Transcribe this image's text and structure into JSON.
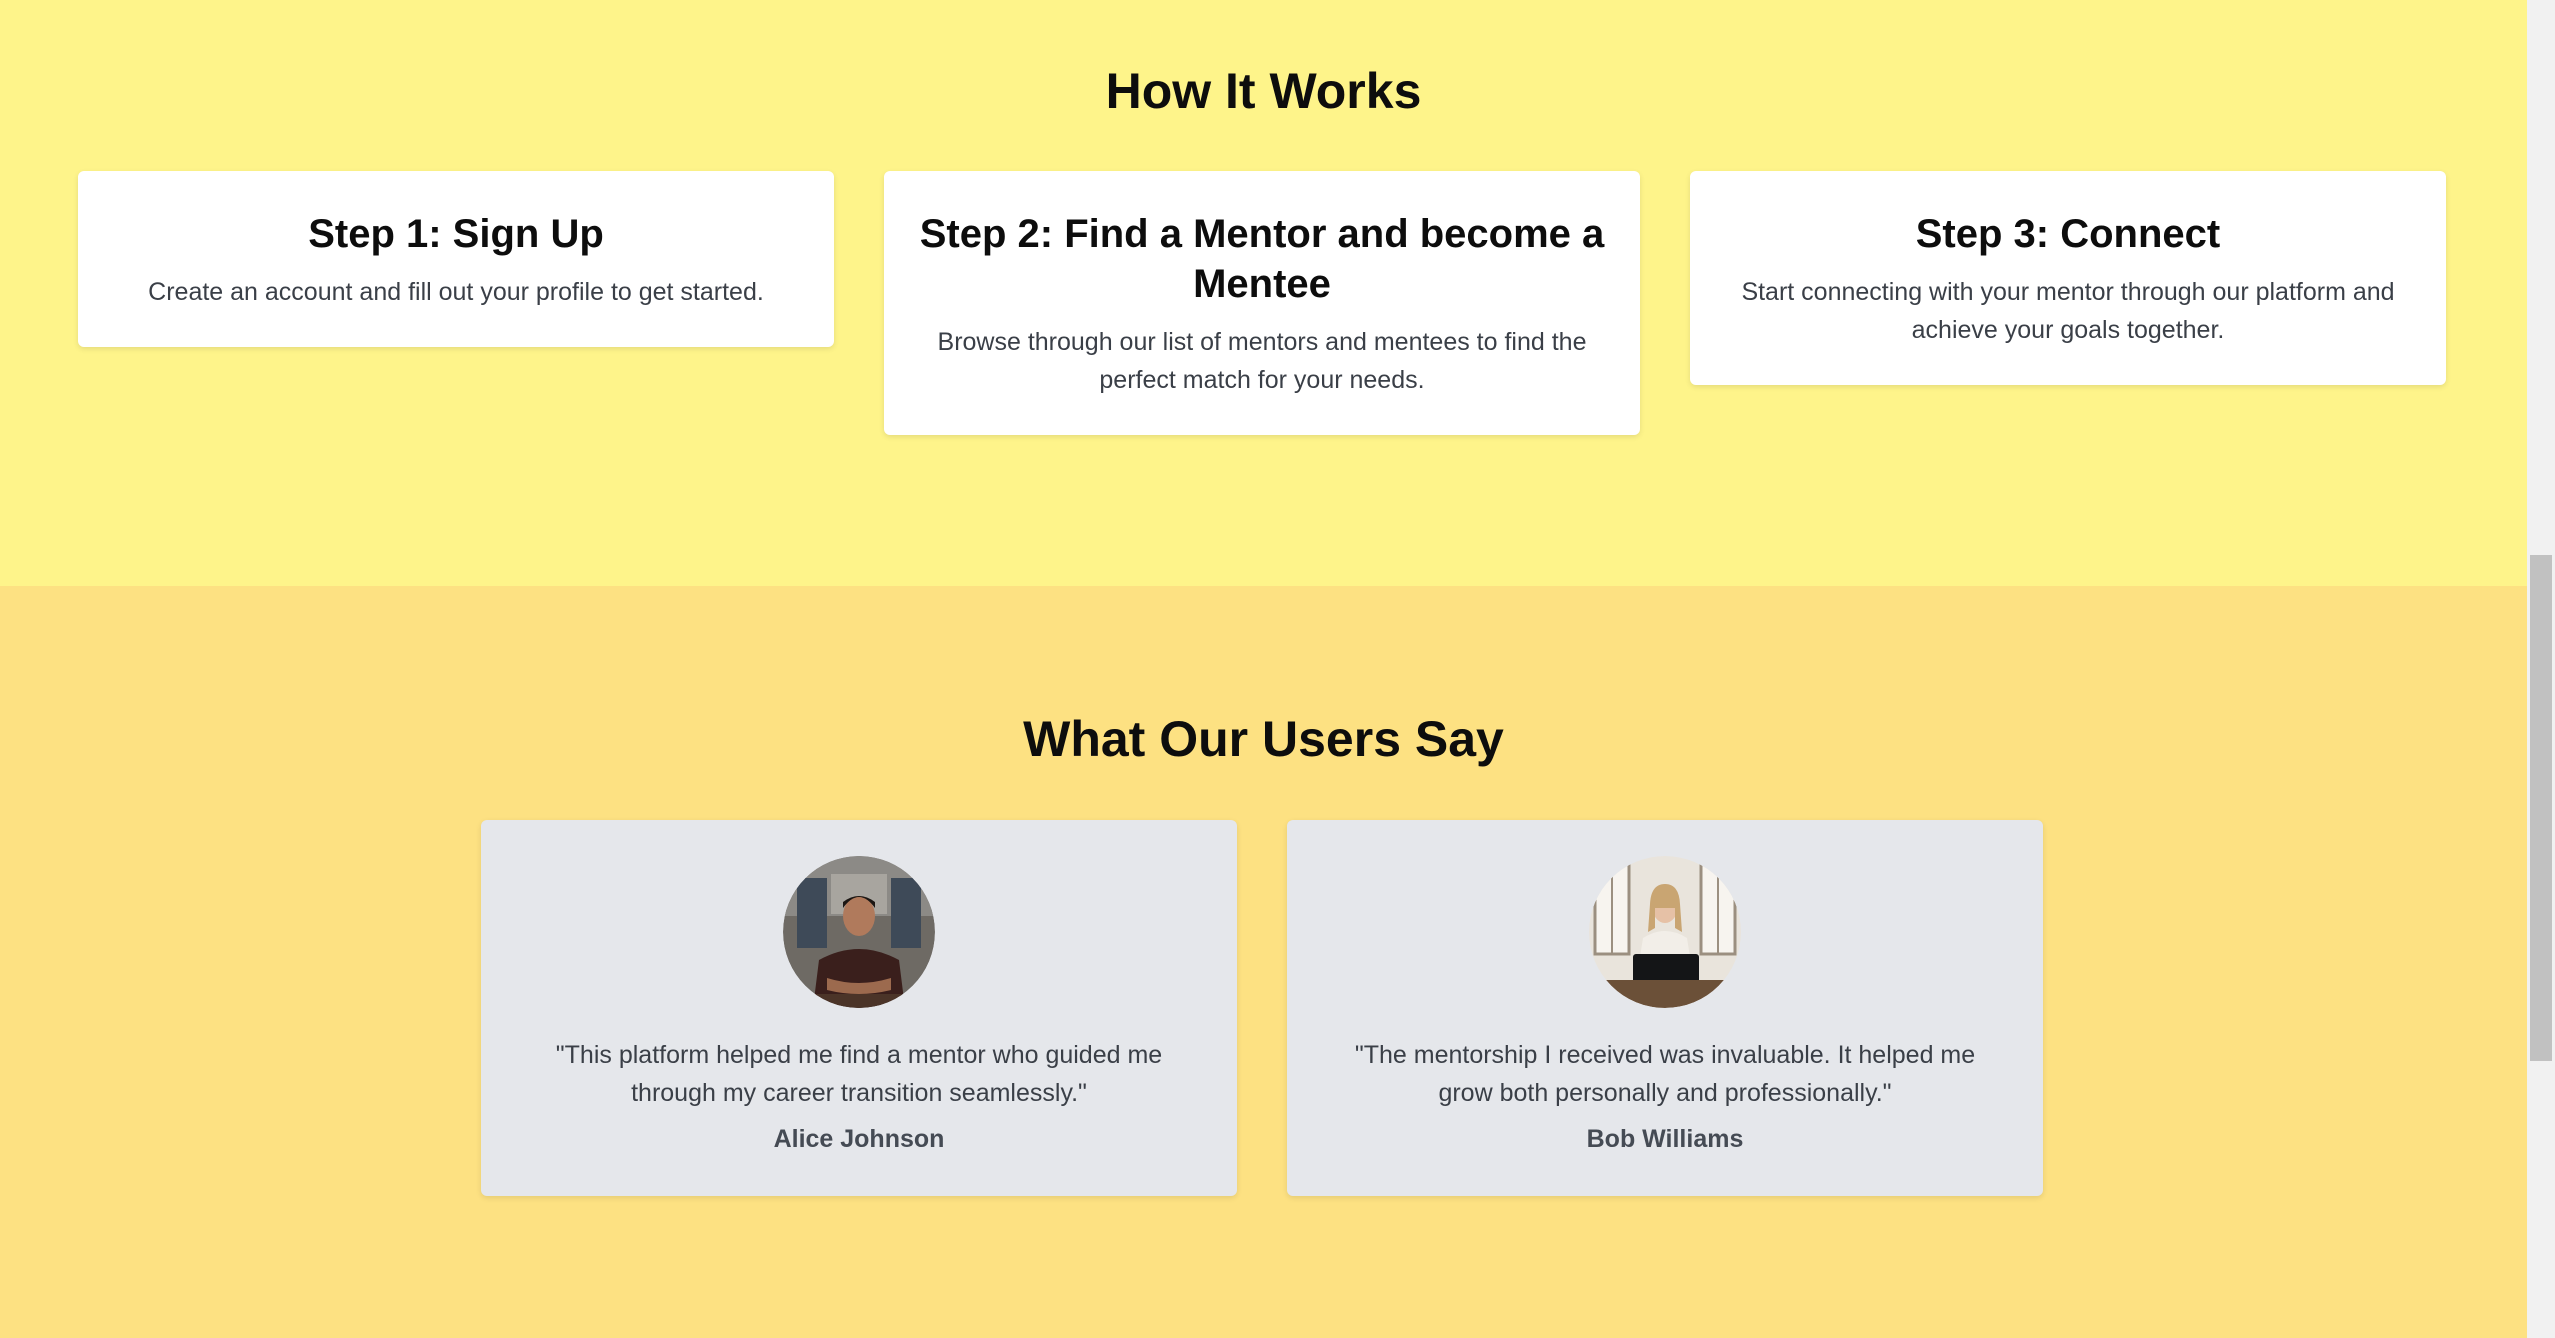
{
  "how_it_works": {
    "title": "How It Works",
    "steps": [
      {
        "title": "Step 1: Sign Up",
        "description": "Create an account and fill out your profile to get started."
      },
      {
        "title": "Step 2: Find a Mentor and become a Mentee",
        "description": "Browse through our list of mentors and mentees to find the perfect match for your needs."
      },
      {
        "title": "Step 3: Connect",
        "description": "Start connecting with your mentor through our platform and achieve your goals together."
      }
    ]
  },
  "testimonials": {
    "title": "What Our Users Say",
    "items": [
      {
        "quote": "\"This platform helped me find a mentor who guided me through my career transition seamlessly.\"",
        "author": "Alice Johnson",
        "avatar_icon": "avatar-photo-man"
      },
      {
        "quote": "\"The mentorship I received was invaluable. It helped me grow both personally and professionally.\"",
        "author": "Bob Williams",
        "avatar_icon": "avatar-photo-woman-laptop"
      }
    ]
  },
  "colors": {
    "how_section_bg": "#fef48a",
    "users_section_bg": "#fde182",
    "step_card_bg": "#ffffff",
    "testimonial_card_bg": "#e5e7eb"
  }
}
